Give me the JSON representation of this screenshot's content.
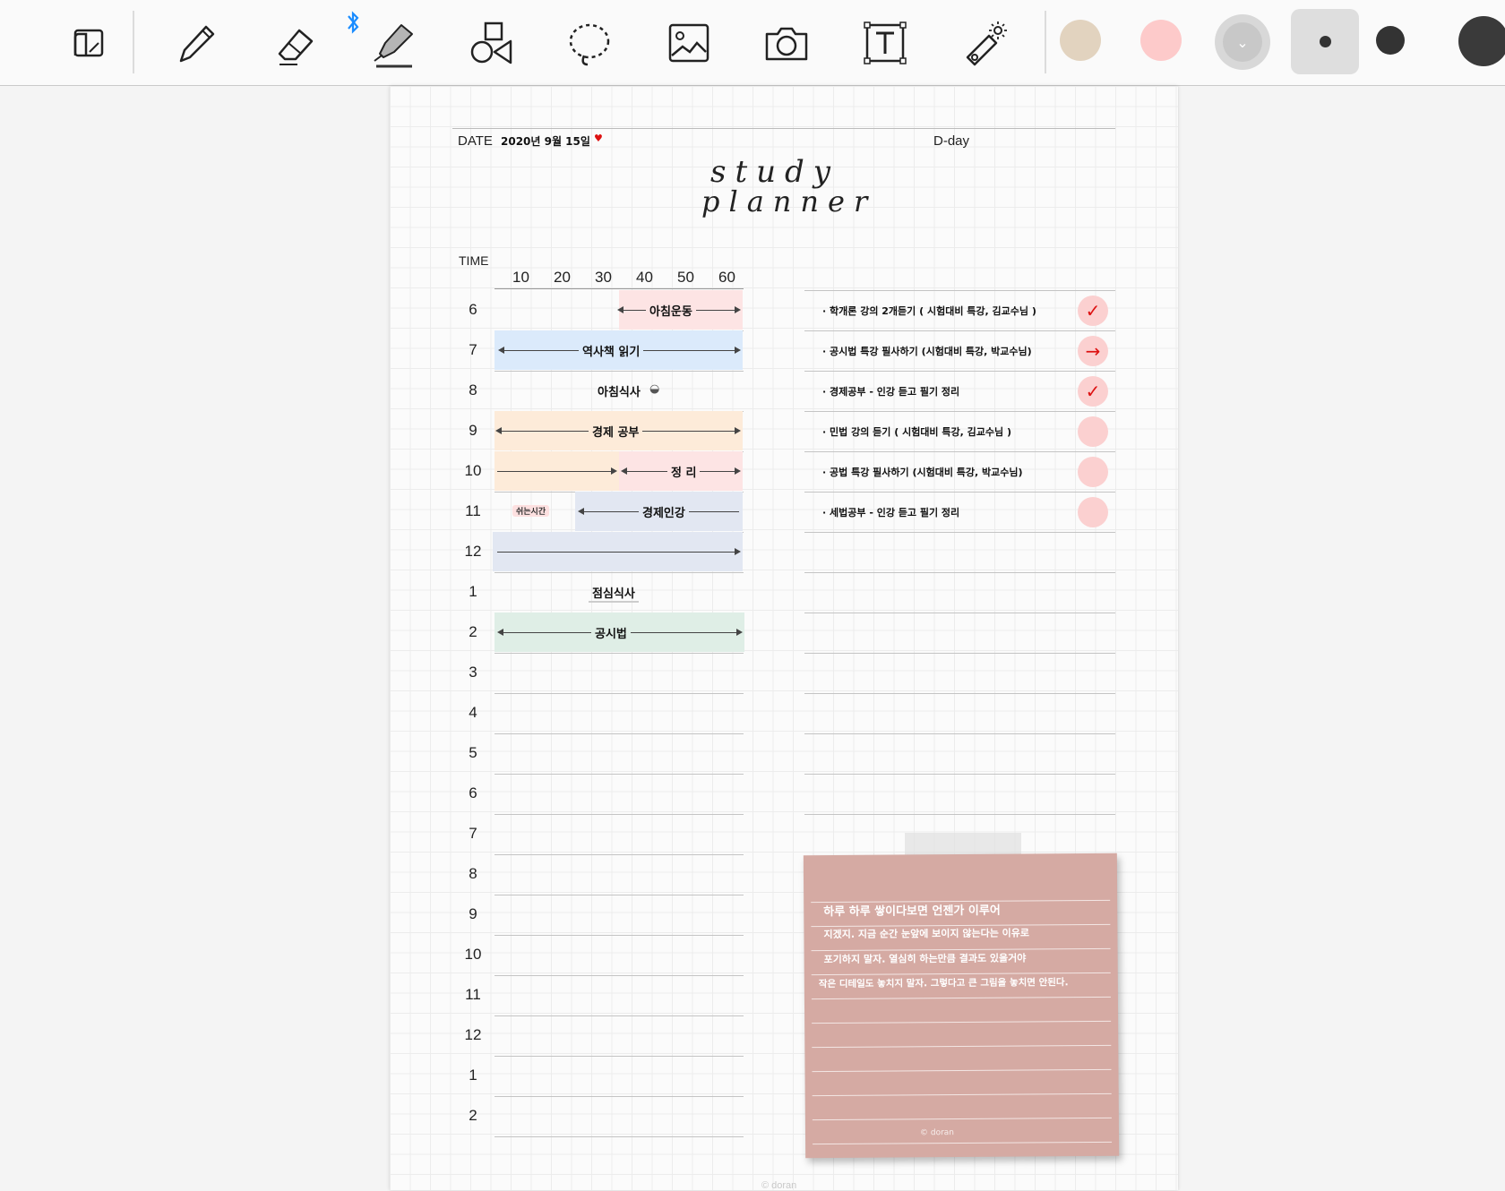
{
  "toolbar": {
    "tools": [
      {
        "name": "layout-icon"
      },
      {
        "name": "pen-icon"
      },
      {
        "name": "eraser-icon"
      },
      {
        "name": "highlighter-icon"
      },
      {
        "name": "shapes-icon"
      },
      {
        "name": "lasso-icon"
      },
      {
        "name": "image-icon"
      },
      {
        "name": "camera-icon"
      },
      {
        "name": "text-icon"
      },
      {
        "name": "laser-pointer-icon"
      }
    ],
    "colors": [
      "#e2d3bf",
      "#fdcaca",
      "#c8c8c8"
    ],
    "accent": "#1a8cff"
  },
  "page": {
    "date_label": "DATE",
    "date_value": "2020년 9월 15일",
    "dday_label": "D-day",
    "title_line1": "study",
    "title_line2": "planner",
    "time_label": "TIME",
    "minutes": [
      "10",
      "20",
      "30",
      "40",
      "50",
      "60"
    ],
    "hours": [
      "6",
      "7",
      "8",
      "9",
      "10",
      "11",
      "12",
      "1",
      "2",
      "3",
      "4",
      "5",
      "6",
      "7",
      "8",
      "9",
      "10",
      "11",
      "12",
      "1",
      "2"
    ],
    "schedule": {
      "morning_exercise": "아침운동",
      "history_book": "역사책 읽기",
      "breakfast": "아침식사",
      "economics_study": "경제 공부",
      "review": "정 리",
      "break_time": "쉬는시간",
      "economics_lecture": "경제인강",
      "lunch": "점심식사",
      "public_law": "공시법"
    },
    "todos": [
      {
        "text": "· 학개론 강의 2개듣기 ( 시험대비 특강, 김교수님 )",
        "mark": "✓"
      },
      {
        "text": "· 공시법 특강 필사하기 (시험대비 특강, 박교수님)",
        "mark": "→"
      },
      {
        "text": "· 경제공부 - 인강 듣고 필기 정리",
        "mark": "✓"
      },
      {
        "text": "· 민법 강의 듣기 ( 시험대비 특강, 김교수님 )",
        "mark": ""
      },
      {
        "text": "· 공법 특강 필사하기 (시험대비 특강, 박교수님)",
        "mark": ""
      },
      {
        "text": "· 세법공부 - 인강 듣고 필기 정리",
        "mark": ""
      }
    ],
    "note_lines": [
      "하루 하루  쌓이다보면  언젠가  이루어",
      "지겠지. 지금 순간 눈앞에 보이지 않는다는 이유로",
      "포기하지 말자. 열심히 하는만큼 결과도 있을거야",
      "작은 디테일도 놓치지 말자. 그렇다고 큰 그림을 놓치면 안된다."
    ],
    "footer": "© doran"
  }
}
